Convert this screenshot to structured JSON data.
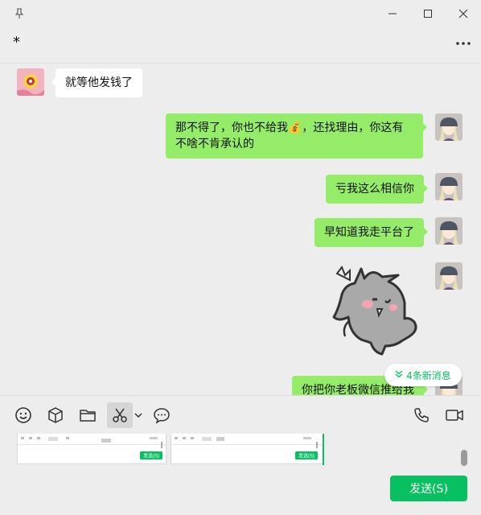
{
  "window": {
    "pin_icon": "pin-icon",
    "minimize_icon": "minimize-icon",
    "maximize_icon": "maximize-icon",
    "close_icon": "close-icon"
  },
  "header": {
    "title": "*",
    "more_icon": "more-icon"
  },
  "messages": [
    {
      "side": "in",
      "text": "就等他发钱了"
    },
    {
      "side": "out",
      "text": "那不得了，你也不给我💰，还找理由，你这有不啥不肯承认的"
    },
    {
      "side": "out",
      "text": "亏我这么相信你"
    },
    {
      "side": "out",
      "text": "早知道我走平台了"
    },
    {
      "side": "out",
      "type": "sticker",
      "icon": "rhino-sticker"
    },
    {
      "side": "out",
      "text": "你把你老板微信推给我"
    }
  ],
  "new_messages": {
    "label": "4条新消息",
    "icon": "double-chevron-down-icon"
  },
  "toolbar": {
    "left_icons": [
      "emoji-icon",
      "cube-icon",
      "folder-icon",
      "scissors-icon",
      "chevron-down-icon",
      "chat-bubble-icon"
    ],
    "right_icons": [
      "phone-icon",
      "video-icon"
    ]
  },
  "composer": {
    "send_label": "发送(S)",
    "thumb_send_label": "发送(S)"
  },
  "colors": {
    "accent": "#07c160",
    "outgoing_bubble": "#95ec69",
    "background": "#ededed"
  }
}
